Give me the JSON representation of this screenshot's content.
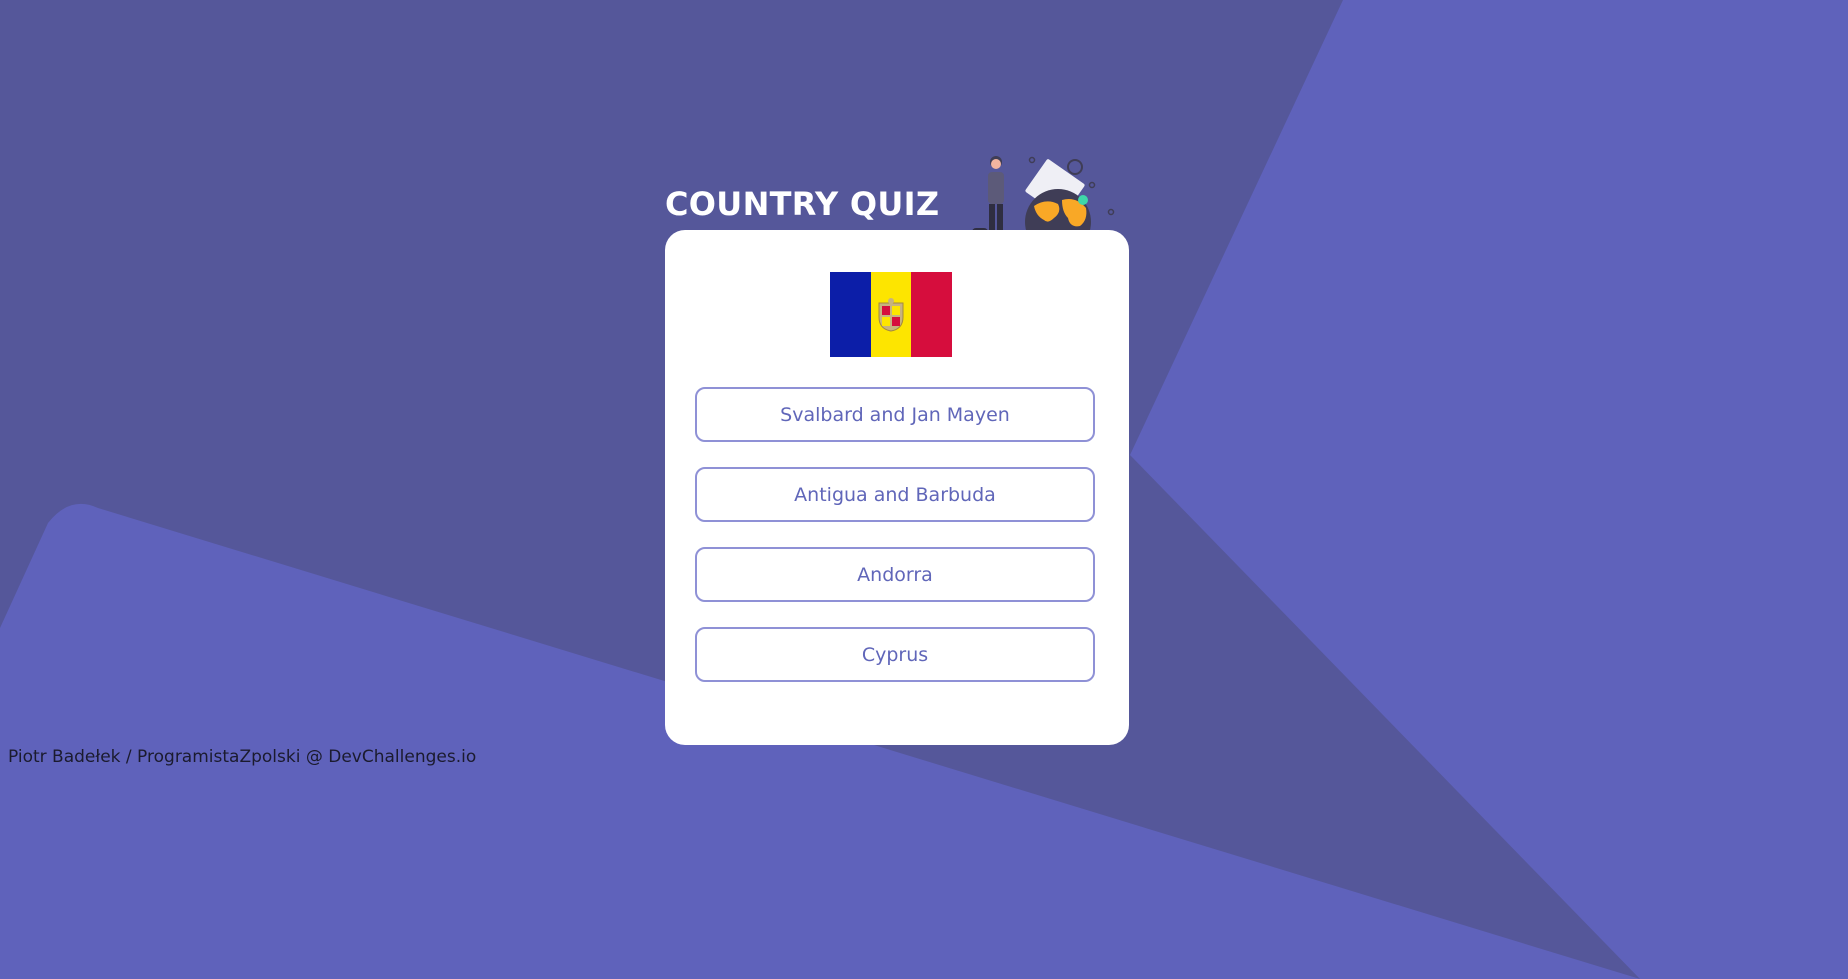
{
  "colors": {
    "background_dark": "#55579a",
    "background_light": "#5f62bb",
    "card": "#ffffff",
    "option_border": "#8f91d6",
    "option_text": "#6066b9"
  },
  "header": {
    "title": "COUNTRY QUIZ"
  },
  "question": {
    "flag": {
      "country_icon": "andorra-flag-icon",
      "colors": [
        "#0c1ea8",
        "#fde500",
        "#d60d3d"
      ]
    }
  },
  "options": [
    {
      "label": "Svalbard and Jan Mayen"
    },
    {
      "label": "Antigua and Barbuda"
    },
    {
      "label": "Andorra"
    },
    {
      "label": "Cyprus"
    }
  ],
  "footer": {
    "credit": "Piotr Badełek / ProgramistaZpolski @ DevChallenges.io"
  }
}
